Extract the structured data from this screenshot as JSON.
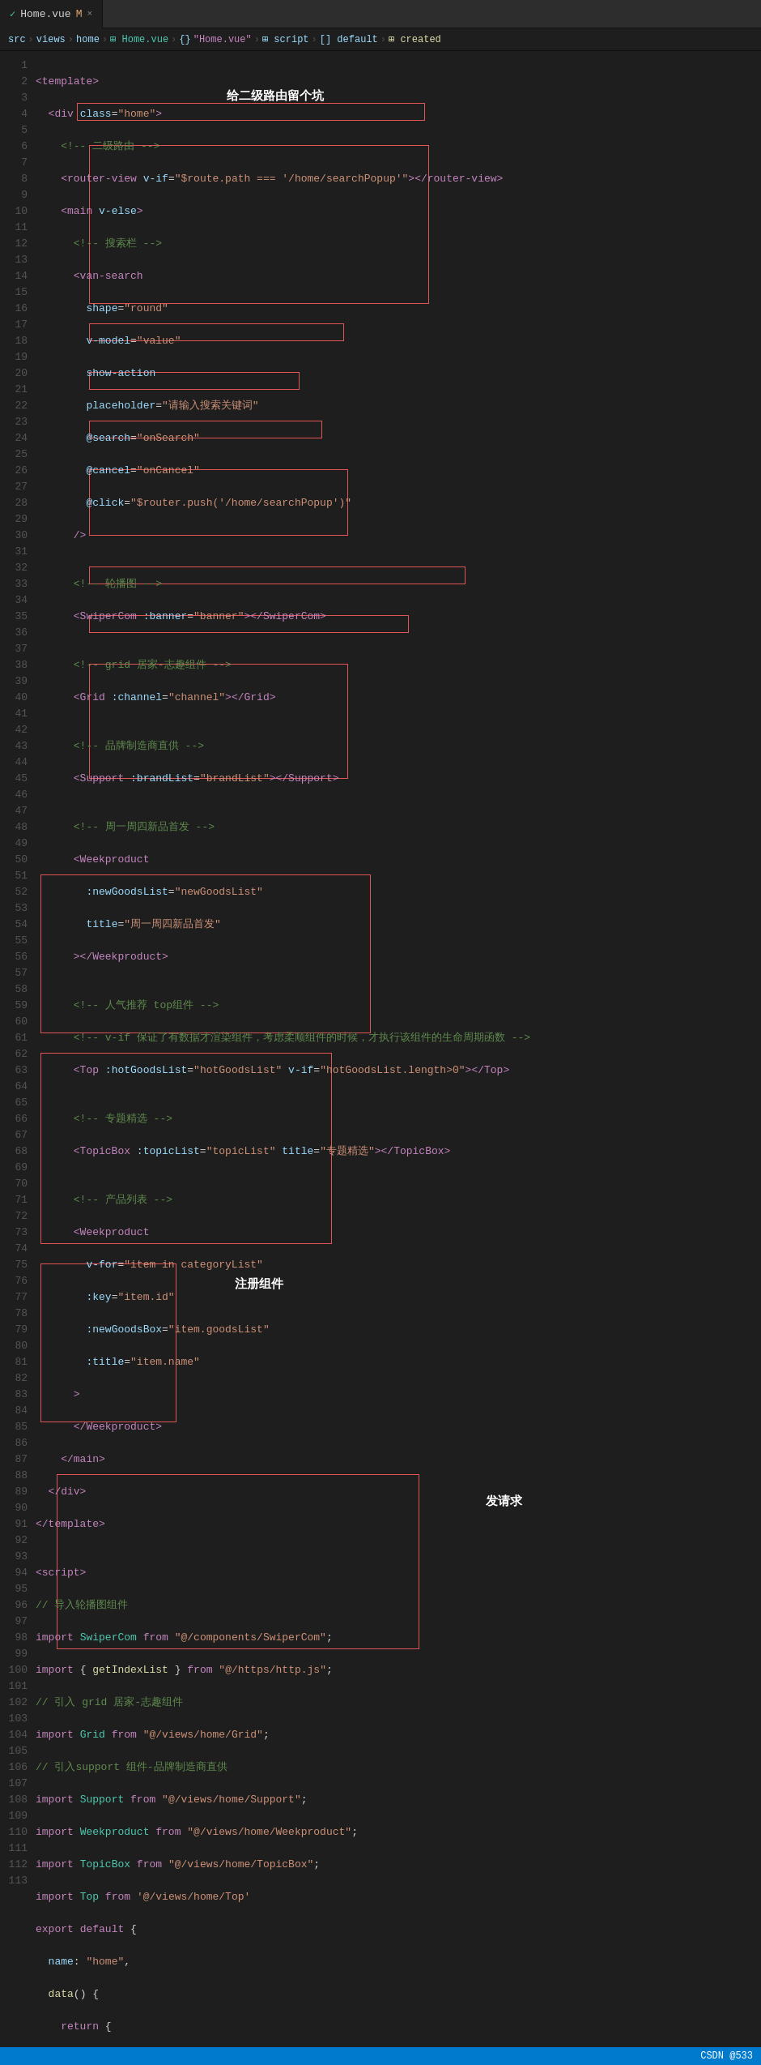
{
  "tab": {
    "active_label": "Home.vue",
    "active_modified": "M",
    "inactive_label": "×"
  },
  "breadcrumb": {
    "parts": [
      "src",
      ">",
      "views",
      ">",
      "home",
      ">",
      "Home.vue",
      ">",
      "{}",
      "\"Home.vue\"",
      ">",
      "script",
      ">",
      "[] default",
      ">",
      "created"
    ]
  },
  "annotation_title": "给二级路由留个坑",
  "annotation_register": "注册组件",
  "annotation_request": "发请求",
  "status_bar": {
    "right_text": "CSDN @533"
  }
}
